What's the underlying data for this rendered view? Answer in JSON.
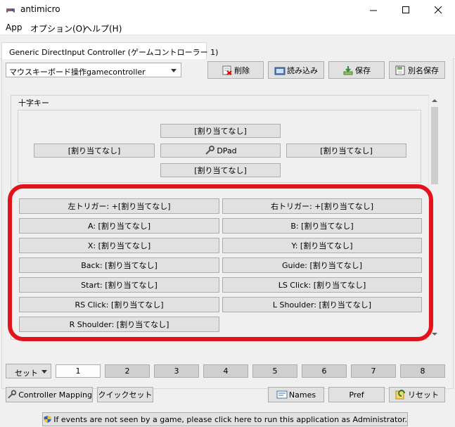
{
  "window": {
    "title": "antimicro"
  },
  "menu": [
    {
      "label": "App"
    },
    {
      "label": "オプション(O)"
    },
    {
      "label": "ヘルプ(H)"
    }
  ],
  "tab": {
    "label": "Generic DirectInput Controller (ゲームコントローラー 1)"
  },
  "profile": {
    "selected": "マウスキーボード操作gamecontroller"
  },
  "toolbar": {
    "delete": "削除",
    "load": "読み込み",
    "save": "保存",
    "save_as": "別名保存"
  },
  "dpad": {
    "group_title": "十字キー",
    "up": "[割り当てなし]",
    "left": "[割り当てなし]",
    "center": "DPad",
    "right": "[割り当てなし]",
    "down": "[割り当てなし]"
  },
  "buttons": [
    "左トリガー: +[割り当てなし]",
    "右トリガー: +[割り当てなし]",
    "A: [割り当てなし]",
    "B: [割り当てなし]",
    "X: [割り当てなし]",
    "Y: [割り当てなし]",
    "Back: [割り当てなし]",
    "Guide: [割り当てなし]",
    "Start: [割り当てなし]",
    "LS Click: [割り当てなし]",
    "RS Click: [割り当てなし]",
    "L Shoulder: [割り当てなし]",
    "R Shoulder: [割り当てなし]"
  ],
  "sets": {
    "combo_label": "セット",
    "items": [
      "1",
      "2",
      "3",
      "4",
      "5",
      "6",
      "7",
      "8"
    ],
    "active": "1"
  },
  "bottom": {
    "controller_mapping": "Controller Mapping",
    "quick_set": "クイックセット",
    "names": "Names",
    "pref": "Pref",
    "reset": "リセット"
  },
  "status": {
    "message": "If events are not seen by a game, please click here to run this application as Administrator."
  }
}
